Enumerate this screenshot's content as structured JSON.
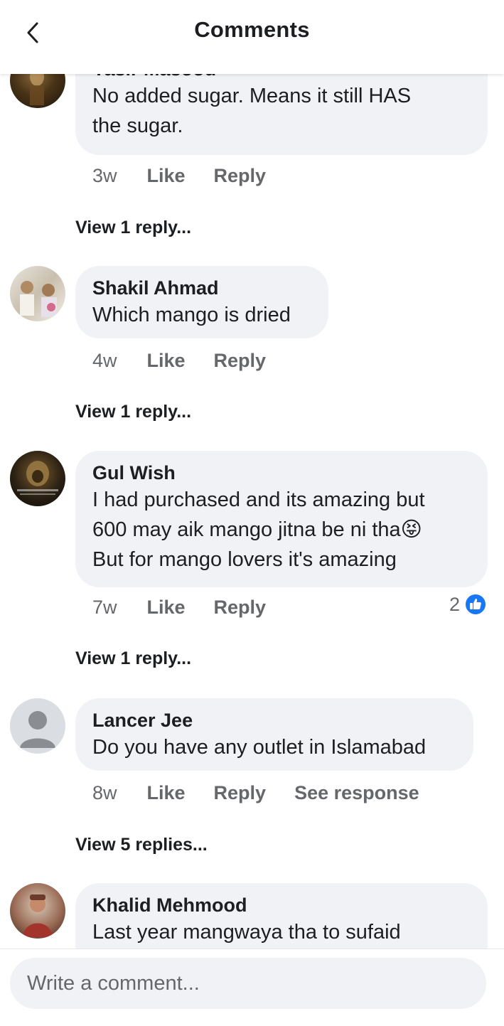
{
  "header": {
    "title": "Comments"
  },
  "comments": [
    {
      "author": "Yasir Masood",
      "lines": [
        "No added sugar. Means it still HAS",
        "the sugar."
      ],
      "time": "3w",
      "like": "Like",
      "reply": "Reply",
      "view_replies": "View 1 reply..."
    },
    {
      "author": "Shakil Ahmad",
      "lines": [
        "Which mango is dried"
      ],
      "time": "4w",
      "like": "Like",
      "reply": "Reply",
      "view_replies": "View 1 reply..."
    },
    {
      "author": "Gul Wish",
      "lines": [
        "I had purchased and its amazing but",
        "600 may aik mango jitna be ni tha😝",
        "But for mango lovers it's amazing"
      ],
      "time": "7w",
      "like": "Like",
      "reply": "Reply",
      "reaction_count": "2",
      "view_replies": "View 1 reply..."
    },
    {
      "author": "Lancer Jee",
      "lines": [
        "Do you have any outlet in Islamabad"
      ],
      "time": "8w",
      "like": "Like",
      "reply": "Reply",
      "see_response": "See response",
      "view_replies": "View 5 replies..."
    },
    {
      "author": "Khalid Mehmood",
      "lines": [
        "Last year mangwaya tha to sufaid"
      ]
    }
  ],
  "composer": {
    "placeholder": "Write a comment..."
  },
  "icons": {
    "back": "chevron-left-icon",
    "like_reaction": "thumbs-up-icon",
    "default_avatar": "person-icon"
  },
  "colors": {
    "bubble": "#f0f2f5",
    "muted": "#65676b",
    "like_blue": "#1877f2"
  }
}
